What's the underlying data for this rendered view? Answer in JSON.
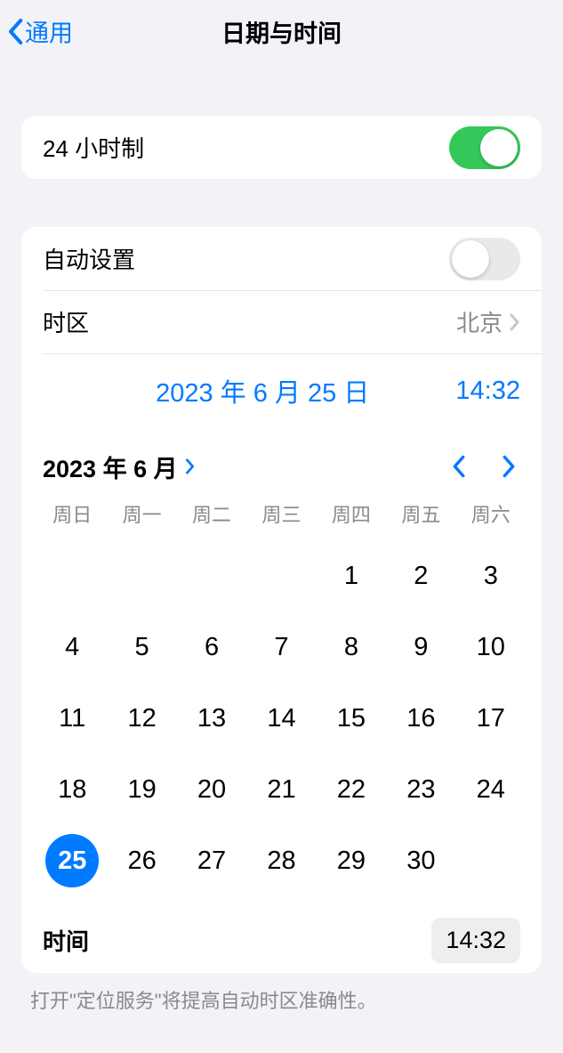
{
  "header": {
    "back_label": "通用",
    "title": "日期与时间"
  },
  "group1": {
    "hour24_label": "24 小时制",
    "hour24_on": true
  },
  "group2": {
    "auto_label": "自动设置",
    "auto_on": false,
    "timezone_label": "时区",
    "timezone_value": "北京",
    "selected_date": "2023 年 6 月 25 日",
    "selected_time": "14:32"
  },
  "calendar": {
    "month_title": "2023 年 6 月",
    "weekdays": [
      "周日",
      "周一",
      "周二",
      "周三",
      "周四",
      "周五",
      "周六"
    ],
    "leading_blanks": 4,
    "days_in_month": 30,
    "selected_day": 25,
    "time_label": "时间",
    "time_value": "14:32"
  },
  "footer": {
    "note": "打开\"定位服务\"将提高自动时区准确性。"
  }
}
